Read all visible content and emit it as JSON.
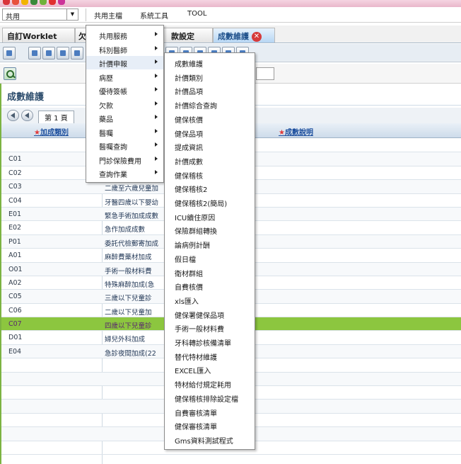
{
  "titlebar": {
    "icon_colors": [
      "#d9343b",
      "#e8503c",
      "#f2b400",
      "#3a8a3a",
      "#6fb23a",
      "#e03030",
      "#cc3399"
    ]
  },
  "menubar": {
    "combo_value": "共用",
    "items": [
      "共用主檔",
      "系統工具",
      "TOOL"
    ]
  },
  "tabs": [
    {
      "label": "自訂Worklet"
    },
    {
      "label": "欠"
    },
    {
      "label": "款設定"
    },
    {
      "label": "成數維護",
      "close": "✕"
    }
  ],
  "panel": {
    "title": "成數維護",
    "page_label": "第 1 頁",
    "columns": [
      {
        "label": "加成類別",
        "marker": "★"
      },
      {
        "label": "成數說明",
        "marker": "★"
      }
    ],
    "rows": [
      {
        "code": "",
        "name": ""
      },
      {
        "code": "C01",
        "name": ""
      },
      {
        "code": "C02",
        "name": ""
      },
      {
        "code": "C03",
        "name": "二歲至六歲兒童加"
      },
      {
        "code": "C04",
        "name": "牙醫四歲以下嬰幼"
      },
      {
        "code": "E01",
        "name": "緊急手術加成成數"
      },
      {
        "code": "E02",
        "name": "急作加成成數"
      },
      {
        "code": "P01",
        "name": "委託代檢郵寄加成"
      },
      {
        "code": "A01",
        "name": "麻醉費藥材加成"
      },
      {
        "code": "O01",
        "name": "手術一般材料費"
      },
      {
        "code": "A02",
        "name": "特殊麻醉加成(急"
      },
      {
        "code": "C05",
        "name": "三歲以下兒童診"
      },
      {
        "code": "C06",
        "name": "二歲以下兒童加"
      },
      {
        "code": "C07",
        "name": "四歲以下兒童診"
      },
      {
        "code": "D01",
        "name": "婦兒外科加成"
      },
      {
        "code": "E04",
        "name": "急診夜間加成(22"
      },
      {
        "code": "",
        "name": ""
      },
      {
        "code": "",
        "name": ""
      },
      {
        "code": "",
        "name": ""
      },
      {
        "code": "",
        "name": ""
      },
      {
        "code": "",
        "name": ""
      },
      {
        "code": "",
        "name": ""
      },
      {
        "code": "",
        "name": ""
      }
    ],
    "selected_index": 13
  },
  "menu_level1": {
    "items": [
      "共用服務",
      "科別醫師",
      "計價申報",
      "病歷",
      "優待簽帳",
      "欠款",
      "藥品",
      "醫囑",
      "醫囑查詢",
      "門診保險費用",
      "查詢作業"
    ]
  },
  "menu_level2": {
    "items": [
      "成數維護",
      "計價類別",
      "計價品項",
      "計價綜合查詢",
      "健保核價",
      "健保品項",
      "提成資訊",
      "計價成數",
      "健保稽核",
      "健保稽核2",
      "健保稽核2(簡局)",
      "ICU續住原因",
      "保險群組轉換",
      "論病例計酬",
      "假日檔",
      "衛材群組",
      "自費核價",
      "xls匯入",
      "健保署健保品項",
      "手術一般材料費",
      "牙科轉診核備清單",
      "替代特材維護",
      "EXCEL匯入",
      "特材給付規定耗用",
      "健保稽核排除設定檔",
      "自費審核清單",
      "健保審核清單",
      "Gms資料測試程式"
    ]
  }
}
